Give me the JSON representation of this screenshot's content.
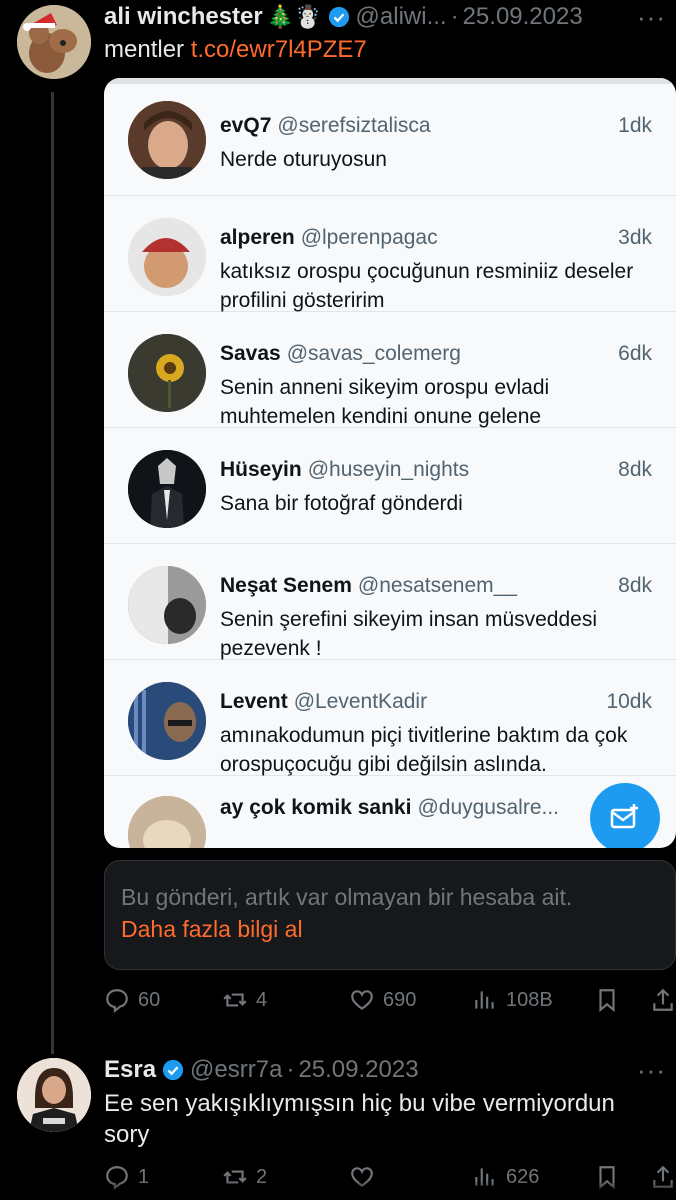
{
  "tweet": {
    "author_name": "ali winchester",
    "author_emojis": "🎄☃️",
    "handle": "@aliwi...",
    "separator": "·",
    "date": "25.09.2023",
    "text_prefix": "mentler",
    "link": "t.co/ewr7l4PZE7",
    "metrics": {
      "replies": "60",
      "retweets": "4",
      "likes": "690",
      "views": "108B"
    }
  },
  "embedded_screenshot": {
    "conversations": [
      {
        "name": "evQ7",
        "handle": "@serefsiztalisca",
        "time": "1dk",
        "message": "Nerde oturuyosun"
      },
      {
        "name": "alperen",
        "handle": "@lperenpagac",
        "time": "3dk",
        "message": "katıksız orospu çocuğunun resminiiz deseler profilini gösteririm"
      },
      {
        "name": "Savas",
        "handle": "@savas_colemerg",
        "time": "6dk",
        "message": "Senin anneni sikeyim orospu evladi muhtemelen kendini onune gelene"
      },
      {
        "name": "Hüseyin",
        "handle": "@huseyin_nights",
        "time": "8dk",
        "message": "Sana bir fotoğraf gönderdi"
      },
      {
        "name": "Neşat Senem",
        "handle": "@nesatsenem__",
        "time": "8dk",
        "message": "Senin şerefini sikeyim insan müsveddesi pezevenk !"
      },
      {
        "name": "Levent",
        "handle": "@LeventKadir",
        "time": "10dk",
        "message": "amınakodumun piçi tivitlerine baktım da çok orospuçocuğu gibi değilsin aslında."
      },
      {
        "name": "ay çok komik sanki",
        "handle": "@duygusalre...",
        "time": "",
        "message": ""
      }
    ]
  },
  "notice": {
    "text": "Bu gönderi, artık var olmayan bir hesaba ait.",
    "link": "Daha fazla bilgi al"
  },
  "reply": {
    "author_name": "Esra",
    "handle": "@esrr7a",
    "separator": "·",
    "date": "25.09.2023",
    "text": "Ee sen yakışıklıymışsın hiç bu vibe vermiyordun sory",
    "metrics": {
      "replies": "1",
      "retweets": "2",
      "likes": "",
      "views": "626"
    }
  },
  "colors": {
    "background": "#000000",
    "link": "#ff6b2c",
    "verified": "#1d9bf0",
    "muted": "#71767b"
  }
}
